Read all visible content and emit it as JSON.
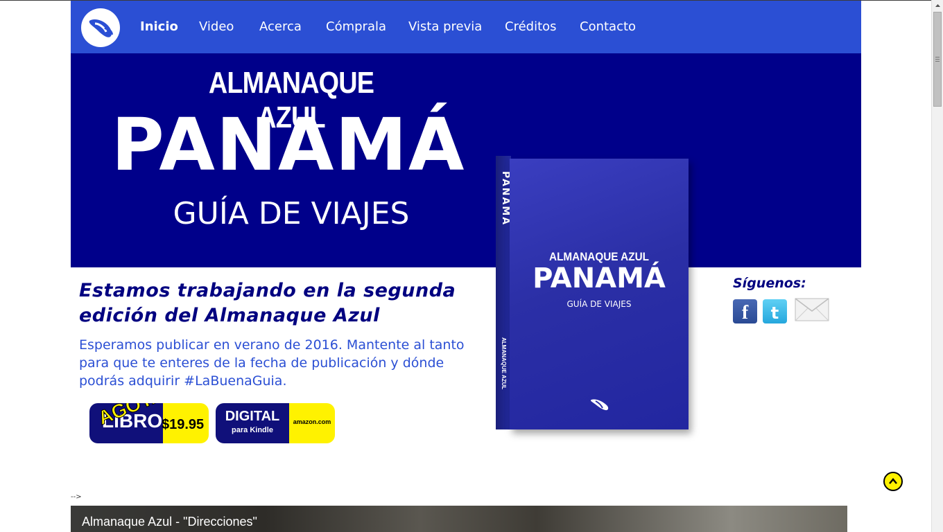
{
  "nav": {
    "items": [
      {
        "label": "Inicio",
        "active": true
      },
      {
        "label": "Video"
      },
      {
        "label": "Acerca"
      },
      {
        "label": "Cómprala"
      },
      {
        "label": "Vista previa"
      },
      {
        "label": "Créditos"
      },
      {
        "label": "Contacto"
      }
    ]
  },
  "hero": {
    "kicker": "ALMANAQUE AZUL",
    "title": "PANAMÁ",
    "subtitle": "GUÍA DE VIAJES"
  },
  "book": {
    "spine_title": "PANAMÁ",
    "spine_brand": "ALMANAQUE AZUL",
    "cover_kicker": "ALMANAQUE AZUL",
    "cover_title": "PANAMÁ",
    "cover_subtitle": "GUÍA DE VIAJES"
  },
  "main": {
    "headline": "Estamos trabajando en la segunda edición del Almanaque Azul",
    "body": "Esperamos publicar en verano de 2016. Mantente al tanto para que te enteres de la fecha de publicación y dónde podrás adquirir #LaBuenaGuia."
  },
  "buttons": {
    "print": {
      "label": "LIBRO",
      "price": "$19.95",
      "overlay": "AGOTADO"
    },
    "digital": {
      "label": "DIGITAL",
      "sub": "para Kindle",
      "store": "amazon.com"
    }
  },
  "social": {
    "heading": "Síguenos:",
    "icons": [
      "facebook-icon",
      "twitter-icon",
      "mail-icon"
    ]
  },
  "stray_text": "-->",
  "video": {
    "title": "Almanaque Azul - \"Direcciones\""
  },
  "colors": {
    "nav_bg": "#2b4fd4",
    "hero_bg": "#00008a",
    "headline": "#000080",
    "body": "#2b4fd4",
    "accent_yellow": "#fff200"
  }
}
